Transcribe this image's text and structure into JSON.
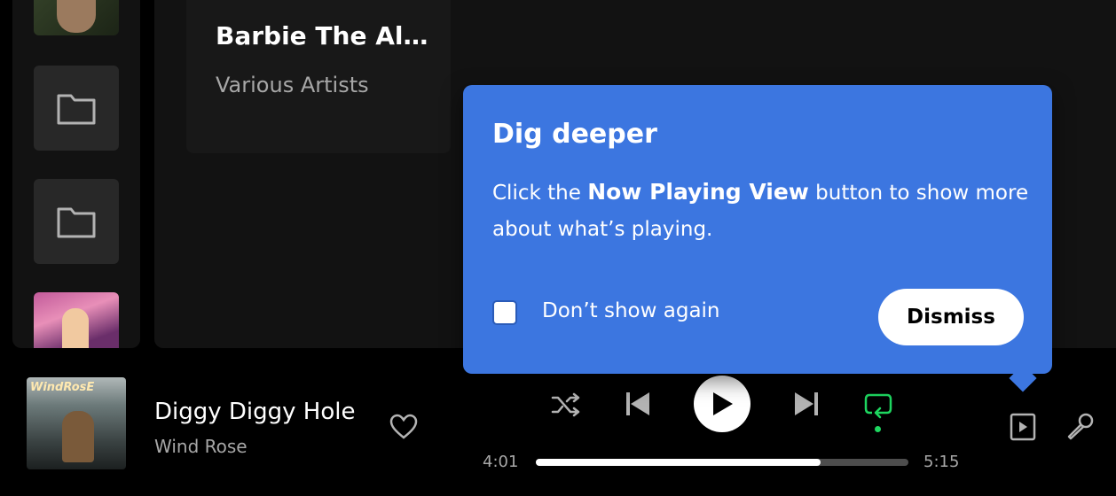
{
  "library": {
    "items": [
      {
        "type": "album-art",
        "icon": "album-art"
      },
      {
        "type": "folder",
        "icon": "folder-icon"
      },
      {
        "type": "folder",
        "icon": "folder-icon"
      },
      {
        "type": "album-art",
        "icon": "album-art"
      }
    ]
  },
  "main": {
    "card": {
      "title": "Barbie The Al...",
      "subtitle": "Various Artists"
    }
  },
  "popover": {
    "title": "Dig deeper",
    "body_prefix": "Click the ",
    "body_bold": "Now Playing View",
    "body_suffix": " button to show more about what’s playing.",
    "checkbox_label": "Don’t show again",
    "checkbox_checked": false,
    "dismiss_label": "Dismiss",
    "background_color": "#3c76e0"
  },
  "player": {
    "track_title": "Diggy Diggy Hole",
    "track_artist": "Wind Rose",
    "album_art_text": "WindRosE",
    "current_time": "4:01",
    "total_time": "5:15",
    "progress": 0.765,
    "repeat_active": true,
    "accent_color": "#1ed760",
    "icons": [
      "heart-icon",
      "shuffle-icon",
      "previous-icon",
      "play-icon",
      "next-icon",
      "repeat-icon",
      "now-playing-view-icon",
      "lyrics-icon"
    ]
  }
}
